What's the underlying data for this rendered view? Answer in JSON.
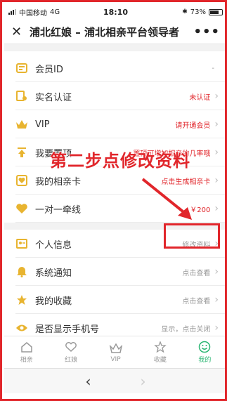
{
  "status_bar": {
    "carrier": "中国移动",
    "network": "4G",
    "time": "18:10",
    "battery": "73%"
  },
  "nav": {
    "title": "浦北红娘 – 浦北相亲平台领导者",
    "more": "•••"
  },
  "rows": [
    {
      "label": "会员ID",
      "value": "-",
      "value_color": "#999",
      "chevron": ""
    },
    {
      "label": "实名认证",
      "value": "未认证",
      "value_color": "#e1262b",
      "chevron": "›"
    },
    {
      "label": "VIP",
      "value": "请开通会员",
      "value_color": "#e1262b",
      "chevron": "›"
    },
    {
      "label": "我要置顶",
      "value": "置顶可增加相亲的几率哦",
      "value_color": "#e1262b",
      "chevron": "›"
    },
    {
      "label": "我的相亲卡",
      "value": "点击生成相亲卡",
      "value_color": "#e1262b",
      "chevron": "›"
    },
    {
      "label": "一对一牵线",
      "value": "￥200",
      "value_color": "#e1262b",
      "chevron": "›"
    },
    {
      "label": "个人信息",
      "value": "修改资料",
      "value_color": "#999",
      "chevron": "›"
    },
    {
      "label": "系统通知",
      "value": "点击查看",
      "value_color": "#999",
      "chevron": "›"
    },
    {
      "label": "我的收藏",
      "value": "点击查看",
      "value_color": "#999",
      "chevron": "›"
    },
    {
      "label": "是否显示手机号",
      "value": "显示，点击关闭",
      "value_color": "#999",
      "chevron": "›"
    }
  ],
  "annotation": {
    "text": "第二步点修改资料"
  },
  "tabs": [
    {
      "label": "相亲",
      "icon": "home-icon"
    },
    {
      "label": "红娘",
      "icon": "heart-icon"
    },
    {
      "label": "VIP",
      "icon": "crown-icon"
    },
    {
      "label": "收藏",
      "icon": "star-icon"
    },
    {
      "label": "我的",
      "icon": "smile-icon",
      "active": true
    }
  ],
  "bottom_nav": {
    "back": "‹",
    "forward": "›"
  },
  "colors": {
    "accent_red": "#e1262b",
    "icon_gold": "#e8b430",
    "tab_active": "#2bb673"
  }
}
